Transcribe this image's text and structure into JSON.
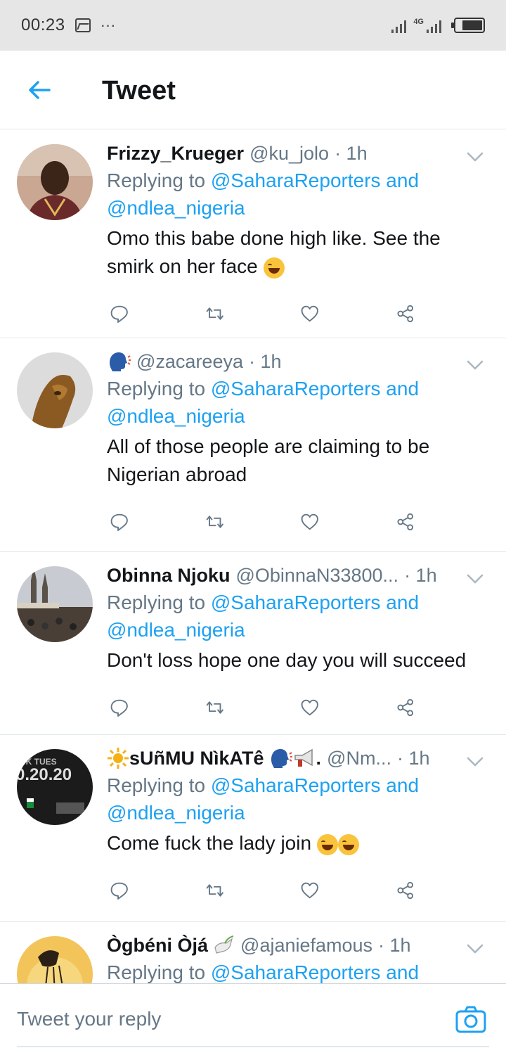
{
  "status_bar": {
    "time": "00:23",
    "dots": "···",
    "network": "4G"
  },
  "header": {
    "title": "Tweet"
  },
  "tweets": [
    {
      "name": "Frizzy_Krueger",
      "handle": "@ku_jolo",
      "time": "· 1h",
      "replying_prefix": "Replying to ",
      "mention1": "@SaharaReporters and",
      "mention2": "@ndlea_nigeria",
      "text1": "Omo this babe done high like. See the",
      "text2": "smirk on her face"
    },
    {
      "name": "",
      "handle": "@zacareeya",
      "time": "· 1h",
      "replying_prefix": "Replying to ",
      "mention1": "@SaharaReporters and",
      "mention2": "@ndlea_nigeria",
      "text1": "All of those people are claiming to be",
      "text2": "Nigerian abroad"
    },
    {
      "name": "Obinna Njoku",
      "handle": "@ObinnaN33800...",
      "time": "· 1h",
      "replying_prefix": "Replying to ",
      "mention1": "@SaharaReporters and",
      "mention2": "@ndlea_nigeria",
      "text1": "Don't loss hope one day you will succeed",
      "text2": ""
    },
    {
      "name": "sUñMU NìkATê",
      "name_suffix": ".",
      "handle": "@Nm...",
      "time": "· 1h",
      "replying_prefix": "Replying to ",
      "mention1": "@SaharaReporters and",
      "mention2": "@ndlea_nigeria",
      "text1": "Come fuck the lady join",
      "text2": ""
    },
    {
      "name": "Ògbéni Òjá",
      "handle": "@ajaniefamous",
      "time": "· 1h",
      "replying_prefix": "Replying to ",
      "mention1": "@SaharaReporters and",
      "mention2": "",
      "text1": "",
      "text2": ""
    }
  ],
  "reply_bar": {
    "placeholder": "Tweet your reply"
  },
  "colors": {
    "accent": "#1da1f2",
    "muted": "#657786",
    "text": "#14171a",
    "divider": "#e1e8ed"
  },
  "icons": [
    "back-arrow-icon",
    "chevron-down-icon",
    "reply-icon",
    "retweet-icon",
    "like-icon",
    "share-icon",
    "camera-icon"
  ]
}
